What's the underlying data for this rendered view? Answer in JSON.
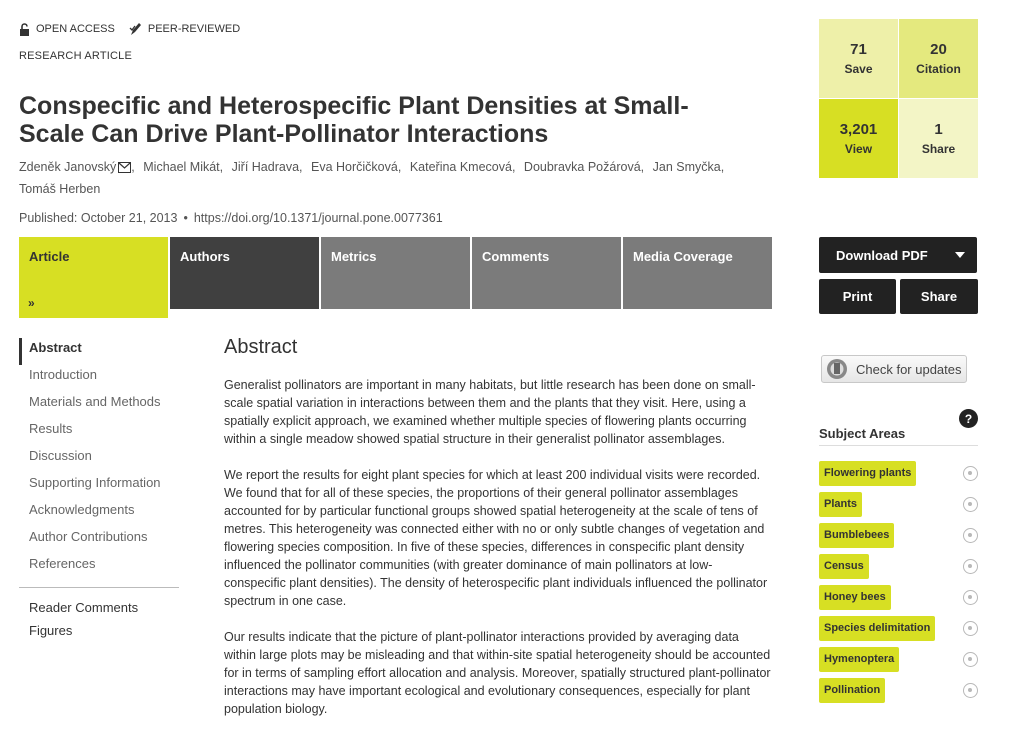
{
  "badges": {
    "open_access": "OPEN ACCESS",
    "peer_reviewed": "PEER-REVIEWED"
  },
  "article_type": "RESEARCH ARTICLE",
  "title": "Conspecific and Heterospecific Plant Densities at Small-Scale Can Drive Plant-Pollinator Interactions",
  "authors": [
    "Zdeněk Janovský",
    "Michael Mikát",
    "Jiří Hadrava",
    "Eva Horčičková",
    "Kateřina Kmecová",
    "Doubravka Požárová",
    "Jan Smyčka",
    "Tomáš Herben"
  ],
  "published": "Published: October 21, 2013",
  "doi": "https://doi.org/10.1371/journal.pone.0077361",
  "tabs": [
    "Article",
    "Authors",
    "Metrics",
    "Comments",
    "Media Coverage"
  ],
  "toc": [
    "Abstract",
    "Introduction",
    "Materials and Methods",
    "Results",
    "Discussion",
    "Supporting Information",
    "Acknowledgments",
    "Author Contributions",
    "References"
  ],
  "toc_extra": [
    "Reader Comments",
    "Figures"
  ],
  "abstract": {
    "heading": "Abstract",
    "paragraphs": [
      "Generalist pollinators are important in many habitats, but little research has been done on small-scale spatial variation in interactions between them and the plants that they visit. Here, using a spatially explicit approach, we examined whether multiple species of flowering plants occurring within a single meadow showed spatial structure in their generalist pollinator assemblages.",
      "We report the results for eight plant species for which at least 200 individual visits were recorded. We found that for all of these species, the proportions of their general pollinator assemblages accounted for by particular functional groups showed spatial heterogeneity at the scale of tens of metres. This heterogeneity was connected either with no or only subtle changes of vegetation and flowering species composition. In five of these species, differences in conspecific plant density influenced the pollinator communities (with greater dominance of main pollinators at low-conspecific plant densities). The density of heterospecific plant individuals influenced the pollinator spectrum in one case.",
      "Our results indicate that the picture of plant-pollinator interactions provided by averaging data within large plots may be misleading and that within-site spatial heterogeneity should be accounted for in terms of sampling effort allocation and analysis. Moreover, spatially structured plant-pollinator interactions may have important ecological and evolutionary consequences, especially for plant population biology."
    ]
  },
  "metrics": [
    {
      "num": "71",
      "label": "Save"
    },
    {
      "num": "20",
      "label": "Citation"
    },
    {
      "num": "3,201",
      "label": "View"
    },
    {
      "num": "1",
      "label": "Share"
    }
  ],
  "buttons": {
    "download": "Download PDF",
    "print": "Print",
    "share": "Share",
    "updates": "Check for updates"
  },
  "subject_areas": {
    "title": "Subject Areas",
    "help": "?",
    "items": [
      "Flowering plants",
      "Plants",
      "Bumblebees",
      "Census",
      "Honey bees",
      "Species delimitation",
      "Hymenoptera",
      "Pollination"
    ]
  }
}
